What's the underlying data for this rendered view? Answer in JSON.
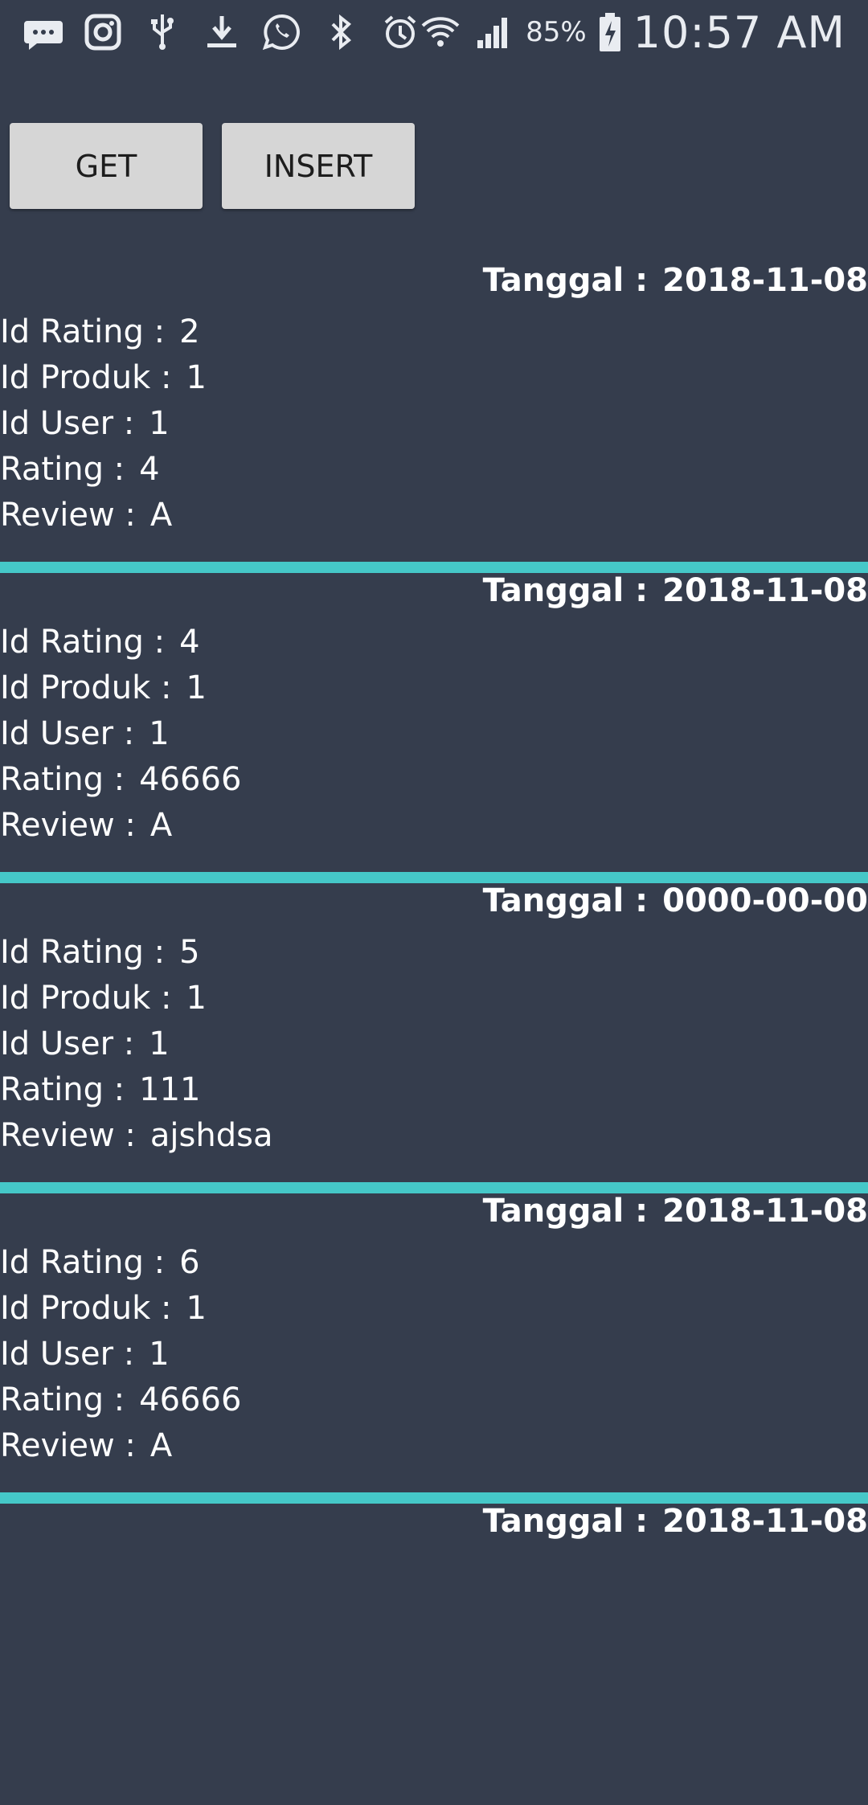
{
  "status_bar": {
    "battery_percent": "85%",
    "time": "10:57 AM",
    "icons": [
      "sms-icon",
      "instagram-icon",
      "usb-icon",
      "download-icon",
      "whatsapp-icon",
      "bluetooth-icon",
      "alarm-icon",
      "wifi-icon",
      "signal-icon",
      "battery-charging-icon"
    ]
  },
  "buttons": {
    "get_label": "GET",
    "insert_label": "INSERT"
  },
  "labels": {
    "tanggal": "Tanggal :",
    "id_rating": "Id Rating :",
    "id_produk": "Id Produk :",
    "id_user": "Id User :",
    "rating": "Rating :",
    "review": "Review :"
  },
  "ratings": [
    {
      "tanggal": "2018-11-08",
      "id_rating": "2",
      "id_produk": "1",
      "id_user": "1",
      "rating": "4",
      "review": "A"
    },
    {
      "tanggal": "2018-11-08",
      "id_rating": "4",
      "id_produk": "1",
      "id_user": "1",
      "rating": "46666",
      "review": "A"
    },
    {
      "tanggal": "0000-00-00",
      "id_rating": "5",
      "id_produk": "1",
      "id_user": "1",
      "rating": "111",
      "review": "ajshdsa"
    },
    {
      "tanggal": "2018-11-08",
      "id_rating": "6",
      "id_produk": "1",
      "id_user": "1",
      "rating": "46666",
      "review": "A"
    },
    {
      "tanggal": "2018-11-08"
    }
  ],
  "colors": {
    "background": "#353d4d",
    "divider": "#45c8c8",
    "button": "#d6d6d6"
  }
}
